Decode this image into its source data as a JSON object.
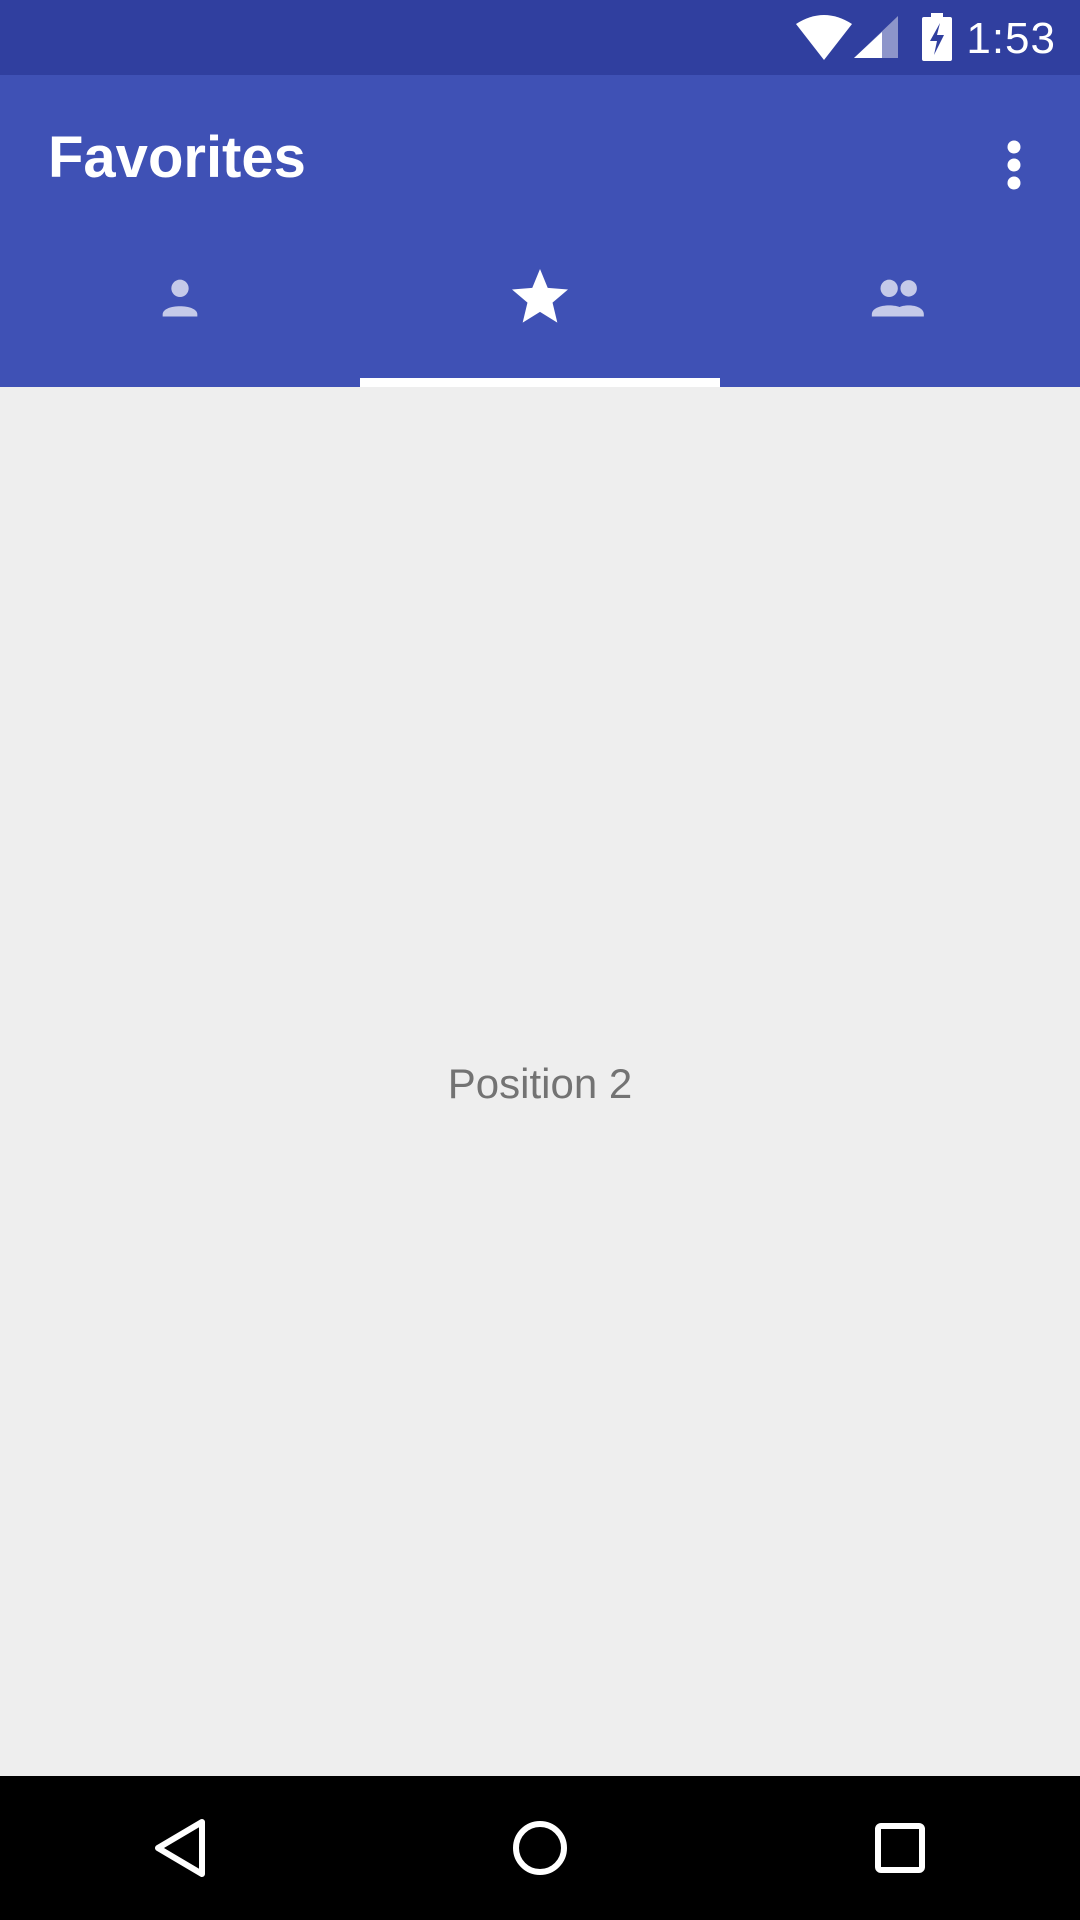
{
  "status_bar": {
    "time": "1:53",
    "icons": [
      "wifi-icon",
      "cell-signal-icon",
      "battery-charging-icon"
    ]
  },
  "app_bar": {
    "title": "Favorites",
    "overflow_icon": "more-vert-icon"
  },
  "tabs": [
    {
      "icon": "person-icon",
      "selected": false
    },
    {
      "icon": "star-icon",
      "selected": true
    },
    {
      "icon": "group-icon",
      "selected": false
    }
  ],
  "content": {
    "label": "Position 2"
  },
  "nav_bar": {
    "icons": [
      "back-icon",
      "home-icon",
      "recents-icon"
    ]
  },
  "colors": {
    "primary": "#3F51B5",
    "primary_dark": "#303F9F",
    "tab_inactive": "#C5CAE9",
    "background": "#EEEEEE",
    "text_secondary": "#737373"
  }
}
